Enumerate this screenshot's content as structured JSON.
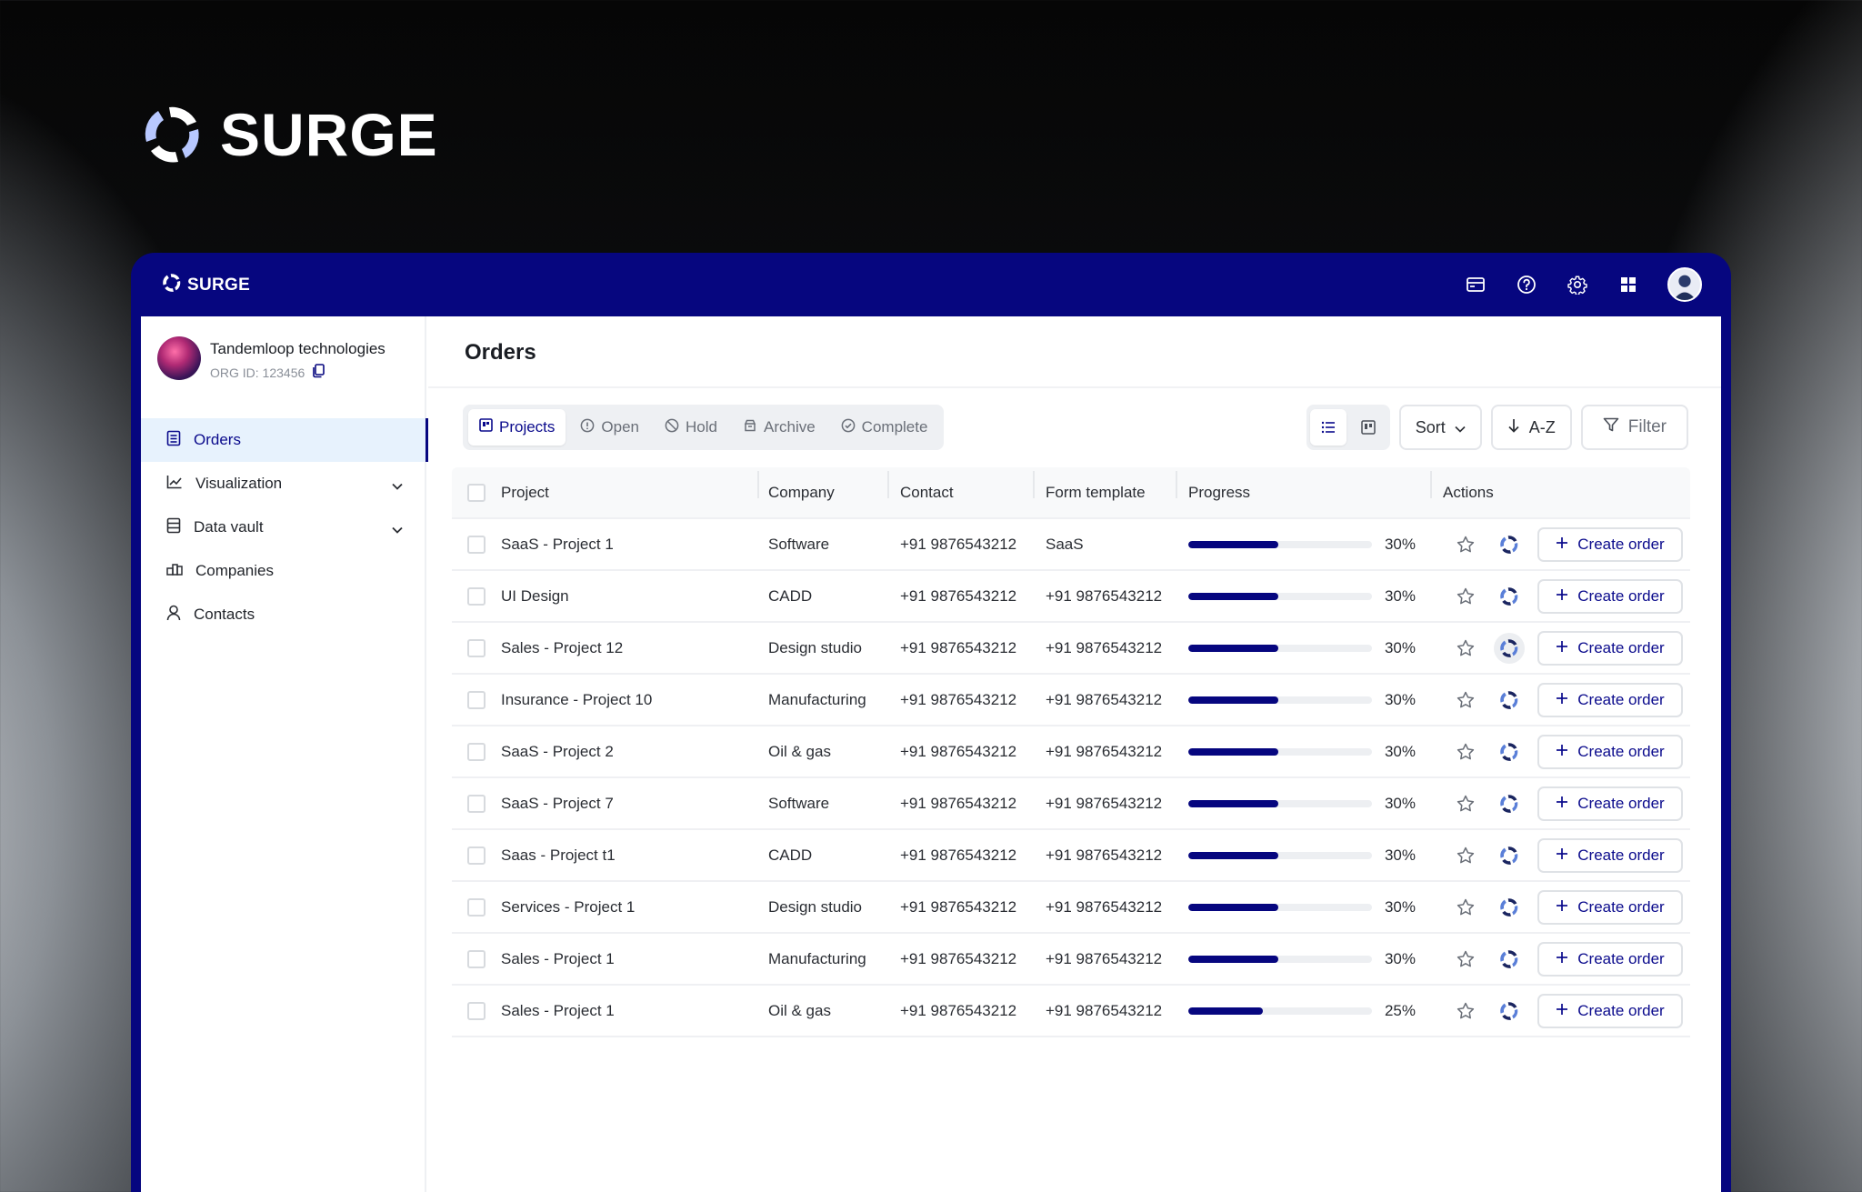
{
  "brand": {
    "name": "SURGE"
  },
  "topbar": {
    "brand_name": "SURGE",
    "icons": [
      "window-icon",
      "help-icon",
      "gear-icon",
      "apps-grid-icon"
    ]
  },
  "org": {
    "name": "Tandemloop technologies",
    "id_label": "ORG ID: 123456"
  },
  "sidebar": {
    "items": [
      {
        "label": "Orders",
        "icon": "orders-icon",
        "active": true
      },
      {
        "label": "Visualization",
        "icon": "chart-line-icon",
        "expandable": true
      },
      {
        "label": "Data vault",
        "icon": "database-icon",
        "expandable": true
      },
      {
        "label": "Companies",
        "icon": "companies-icon"
      },
      {
        "label": "Contacts",
        "icon": "user-icon"
      }
    ]
  },
  "main": {
    "title": "Orders",
    "tabs": [
      {
        "label": "Projects",
        "icon": "projects-icon",
        "active": true
      },
      {
        "label": "Open",
        "icon": "info-circle-icon"
      },
      {
        "label": "Hold",
        "icon": "ban-icon"
      },
      {
        "label": "Archive",
        "icon": "archive-icon"
      },
      {
        "label": "Complete",
        "icon": "check-circle-icon"
      }
    ],
    "controls": {
      "sort_label": "Sort",
      "az_label": "A-Z",
      "filter_label": "Filter"
    }
  },
  "table": {
    "columns": [
      "Project",
      "Company",
      "Contact",
      "Form template",
      "Progress",
      "Actions"
    ],
    "action_label": "Create order",
    "accent": "#06067f",
    "rows": [
      {
        "project": "SaaS - Project 1",
        "company": "Software",
        "contact": "+91 9876543212",
        "form": "SaaS",
        "progress": 30,
        "progress_label": "30%"
      },
      {
        "project": "UI Design",
        "company": "CADD",
        "contact": "+91 9876543212",
        "form": "+91 9876543212",
        "progress": 30,
        "progress_label": "30%"
      },
      {
        "project": "Sales - Project 12",
        "company": "Design studio",
        "contact": "+91 9876543212",
        "form": "+91 9876543212",
        "progress": 30,
        "progress_label": "30%"
      },
      {
        "project": "Insurance - Project 10",
        "company": "Manufacturing",
        "contact": "+91 9876543212",
        "form": "+91 9876543212",
        "progress": 30,
        "progress_label": "30%"
      },
      {
        "project": "SaaS - Project 2",
        "company": "Oil & gas",
        "contact": "+91 9876543212",
        "form": "+91 9876543212",
        "progress": 30,
        "progress_label": "30%"
      },
      {
        "project": "SaaS - Project 7",
        "company": "Software",
        "contact": "+91 9876543212",
        "form": "+91 9876543212",
        "progress": 30,
        "progress_label": "30%"
      },
      {
        "project": "Saas - Project t1",
        "company": "CADD",
        "contact": "+91 9876543212",
        "form": "+91 9876543212",
        "progress": 30,
        "progress_label": "30%"
      },
      {
        "project": "Services - Project 1",
        "company": "Design studio",
        "contact": "+91 9876543212",
        "form": "+91 9876543212",
        "progress": 30,
        "progress_label": "30%"
      },
      {
        "project": "Sales - Project 1",
        "company": "Manufacturing",
        "contact": "+91 9876543212",
        "form": "+91 9876543212",
        "progress": 30,
        "progress_label": "30%"
      },
      {
        "project": "Sales - Project 1",
        "company": "Oil & gas",
        "contact": "+91 9876543212",
        "form": "+91 9876543212",
        "progress": 25,
        "progress_label": "25%"
      }
    ]
  }
}
